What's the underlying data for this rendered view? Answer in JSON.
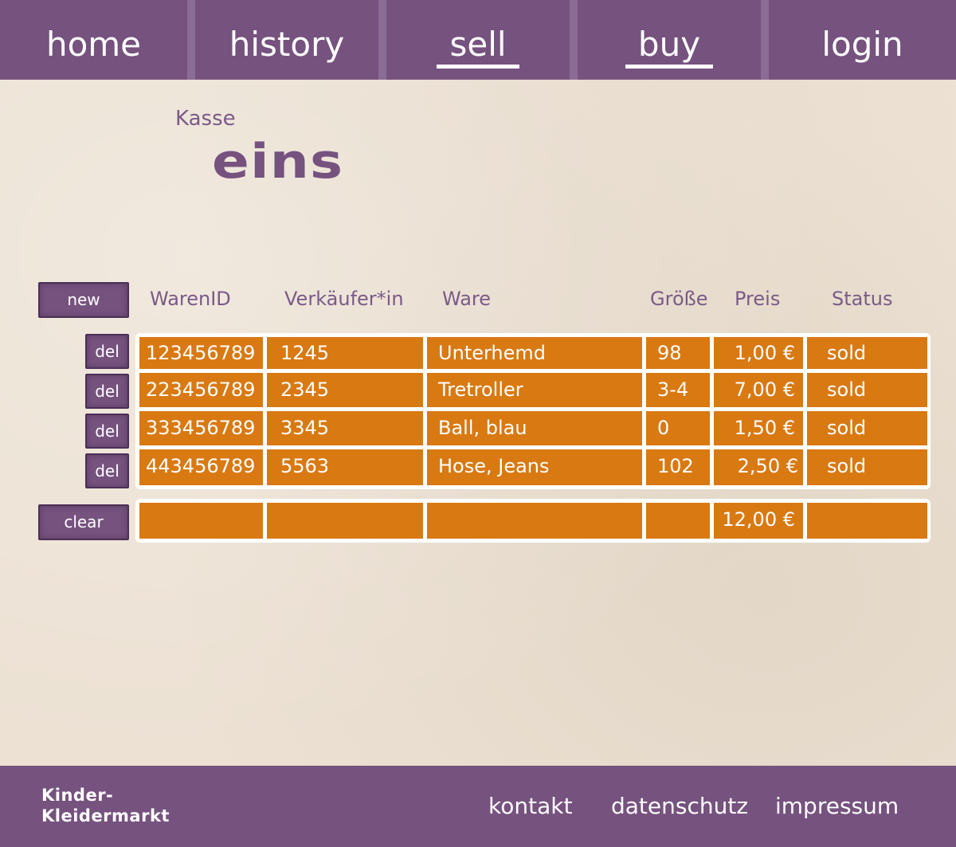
{
  "nav": {
    "home": "home",
    "history": "history",
    "sell": "sell",
    "buy": "buy",
    "login": "login"
  },
  "heading": {
    "label": "Kasse",
    "name": "eins"
  },
  "buttons": {
    "new": "new",
    "clear": "clear",
    "del": "del"
  },
  "table": {
    "columns": [
      "WarenID",
      "Verkäufer*in",
      "Ware",
      "Größe",
      "Preis",
      "Status"
    ],
    "rows": [
      {
        "waren_id": "123456789",
        "verkaeufer": "1245",
        "ware": "Unterhemd",
        "groesse": "98",
        "preis": "1,00 €",
        "status": "sold"
      },
      {
        "waren_id": "223456789",
        "verkaeufer": "2345",
        "ware": "Tretroller",
        "groesse": "3-4",
        "preis": "7,00 €",
        "status": "sold"
      },
      {
        "waren_id": "333456789",
        "verkaeufer": "3345",
        "ware": "Ball, blau",
        "groesse": "0",
        "preis": "1,50 €",
        "status": "sold"
      },
      {
        "waren_id": "443456789",
        "verkaeufer": "5563",
        "ware": "Hose, Jeans",
        "groesse": "102",
        "preis": "2,50 €",
        "status": "sold"
      }
    ],
    "total": "12,00 €"
  },
  "footer": {
    "logo_line1": "Kinder-",
    "logo_line2": "Kleidermarkt",
    "kontakt": "kontakt",
    "datenschutz": "datenschutz",
    "impressum": "impressum"
  },
  "colors": {
    "primary": "#76527f",
    "accent": "#d97912",
    "background": "#ece1d3"
  }
}
